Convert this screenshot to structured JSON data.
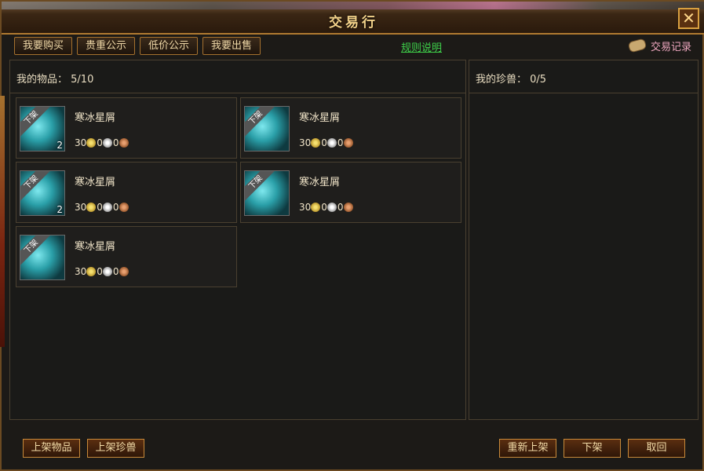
{
  "window": {
    "title": "交易行",
    "close_label": "✕"
  },
  "tabs": [
    "我要购买",
    "贵重公示",
    "低价公示",
    "我要出售"
  ],
  "rules_link": "规则说明",
  "records_label": "交易记录",
  "left_panel": {
    "header_label": "我的物品：",
    "header_value": "5/10"
  },
  "right_panel": {
    "header_label": "我的珍兽：",
    "header_value": "0/5"
  },
  "items": [
    {
      "name": "寒冰星屑",
      "ribbon": "下架",
      "count": "2",
      "gold": "30",
      "silver": "0",
      "copper": "0"
    },
    {
      "name": "寒冰星屑",
      "ribbon": "下架",
      "count": "",
      "gold": "30",
      "silver": "0",
      "copper": "0"
    },
    {
      "name": "寒冰星屑",
      "ribbon": "下架",
      "count": "2",
      "gold": "30",
      "silver": "0",
      "copper": "0"
    },
    {
      "name": "寒冰星屑",
      "ribbon": "下架",
      "count": "",
      "gold": "30",
      "silver": "0",
      "copper": "0"
    },
    {
      "name": "寒冰星屑",
      "ribbon": "下架",
      "count": "",
      "gold": "30",
      "silver": "0",
      "copper": "0"
    }
  ],
  "buttons": {
    "list_item": "上架物品",
    "list_pet": "上架珍兽",
    "relist": "重新上架",
    "delist": "下架",
    "cancel": "取回"
  }
}
